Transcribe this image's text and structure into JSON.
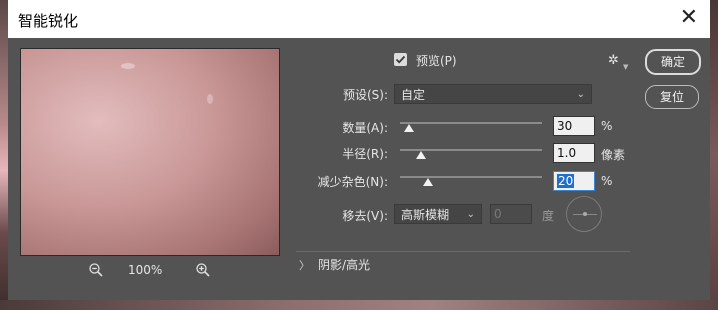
{
  "dialog": {
    "title": "智能锐化",
    "close_glyph": "✕"
  },
  "preview_panel": {
    "zoom_level": "100%"
  },
  "preview_checkbox": {
    "label": "预览(P)",
    "checked": true
  },
  "buttons": {
    "ok": "确定",
    "reset": "复位"
  },
  "preset": {
    "label": "预设(S):",
    "value": "自定"
  },
  "amount": {
    "label": "数量(A):",
    "value": "30",
    "unit": "%",
    "level": 0.06
  },
  "radius": {
    "label": "半径(R):",
    "value": "1.0",
    "unit": "像素",
    "level": 0.15
  },
  "noise": {
    "label": "减少杂色(N):",
    "value": "20",
    "unit": "%",
    "level": 0.2
  },
  "remove": {
    "label": "移去(V):",
    "value": "高斯模糊",
    "angle_value": "0",
    "angle_unit": "度"
  },
  "shadows_highlights": {
    "label": "阴影/高光",
    "expanded": false
  },
  "icons": {
    "close": "close-icon",
    "zoom_out": "zoom-out-icon",
    "zoom_in": "zoom-in-icon",
    "gear": "gear-icon",
    "check": "checkmark-icon",
    "dropdown": "chevron-down-icon",
    "expand": "chevron-right-icon"
  },
  "colors": {
    "dialog_bg": "#535353",
    "titlebar_bg": "#ffffff",
    "selection": "#1e6fd0"
  }
}
